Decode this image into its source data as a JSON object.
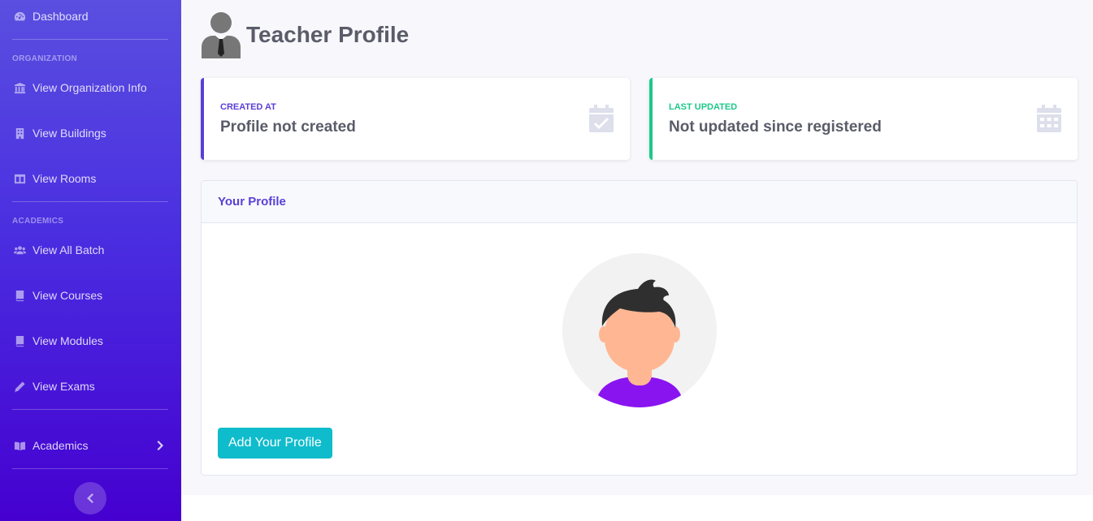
{
  "sidebar": {
    "dashboard": "Dashboard",
    "heading_org": "ORGANIZATION",
    "org_info": "View Organization Info",
    "buildings": "View Buildings",
    "rooms": "View Rooms",
    "heading_academics": "ACADEMICS",
    "batch": "View All Batch",
    "courses": "View Courses",
    "modules": "View Modules",
    "exams": "View Exams",
    "academics": "Academics"
  },
  "page": {
    "title": "Teacher Profile"
  },
  "stats": {
    "created": {
      "label": "CREATED AT",
      "value": "Profile not created",
      "color": "#5a3fd6"
    },
    "updated": {
      "label": "LAST UPDATED",
      "value": "Not updated since registered",
      "color": "#1cc88a"
    }
  },
  "profile": {
    "title": "Your Profile",
    "button": "Add Your Profile"
  },
  "icons": {
    "dashboard": "tachometer-icon",
    "org": "university-icon",
    "buildings": "building-icon",
    "rooms": "columns-icon",
    "batch": "users-icon",
    "courses": "book-icon",
    "modules": "book-icon",
    "exams": "pencil-icon",
    "academics": "book-open-icon"
  }
}
